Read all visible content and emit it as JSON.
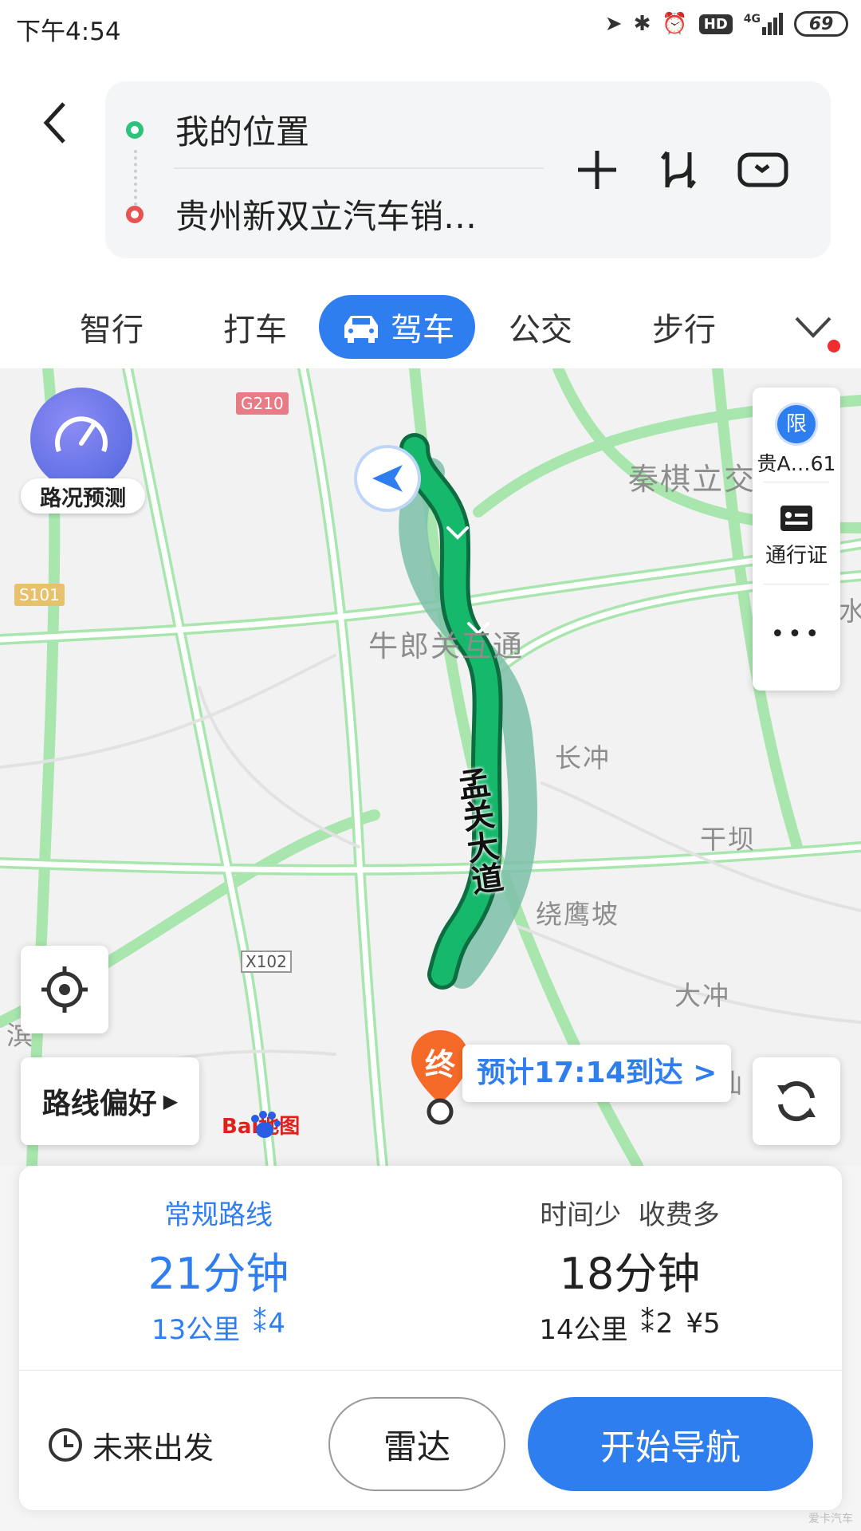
{
  "status_bar": {
    "time": "下午4:54",
    "network": "4G",
    "hd": "HD",
    "battery": "69"
  },
  "search": {
    "origin": "我的位置",
    "destination": "贵州新双立汽车销…"
  },
  "tabs": [
    {
      "label": "智行",
      "active": false
    },
    {
      "label": "打车",
      "active": false
    },
    {
      "label": "驾车",
      "active": true
    },
    {
      "label": "公交",
      "active": false
    },
    {
      "label": "步行",
      "active": false
    }
  ],
  "map": {
    "traffic_predict": "路况预测",
    "road_badges": {
      "g210": "G210",
      "s101": "S101",
      "x102": "X102"
    },
    "place_labels": {
      "qinqi": "秦棋立交",
      "niulang": "牛郎关互通",
      "changchong": "长冲",
      "ganba": "干坝",
      "raoyingpo": "绕鹰坡",
      "dachong": "大冲",
      "xian": "仙",
      "qiao": "水",
      "lu": "滨",
      "road_name": "孟关大道"
    },
    "end_marker": "终",
    "eta": "预计17:14到达 >",
    "limit_badge": "限",
    "plate": "贵A…61",
    "pass_label": "通行证",
    "more": "•••",
    "route_pref": "路线偏好",
    "logo_text": "Bai地图"
  },
  "routes": [
    {
      "tag": "常规路线",
      "duration": "21分钟",
      "distance": "13公里",
      "lights": "4",
      "toll": "",
      "selected": true
    },
    {
      "tag": "时间少  收费多",
      "duration": "18分钟",
      "distance": "14公里",
      "lights": "2",
      "toll": "¥5",
      "selected": false
    }
  ],
  "actions": {
    "future_depart": "未来出发",
    "radar": "雷达",
    "start_nav": "开始导航"
  },
  "colors": {
    "accent": "#2f7ef0",
    "route_green": "#16b86b",
    "route_alt": "#7cc0a8",
    "road_green": "#a8e6ae",
    "end_marker": "#f56a28"
  },
  "watermark": "爱卡汽车"
}
